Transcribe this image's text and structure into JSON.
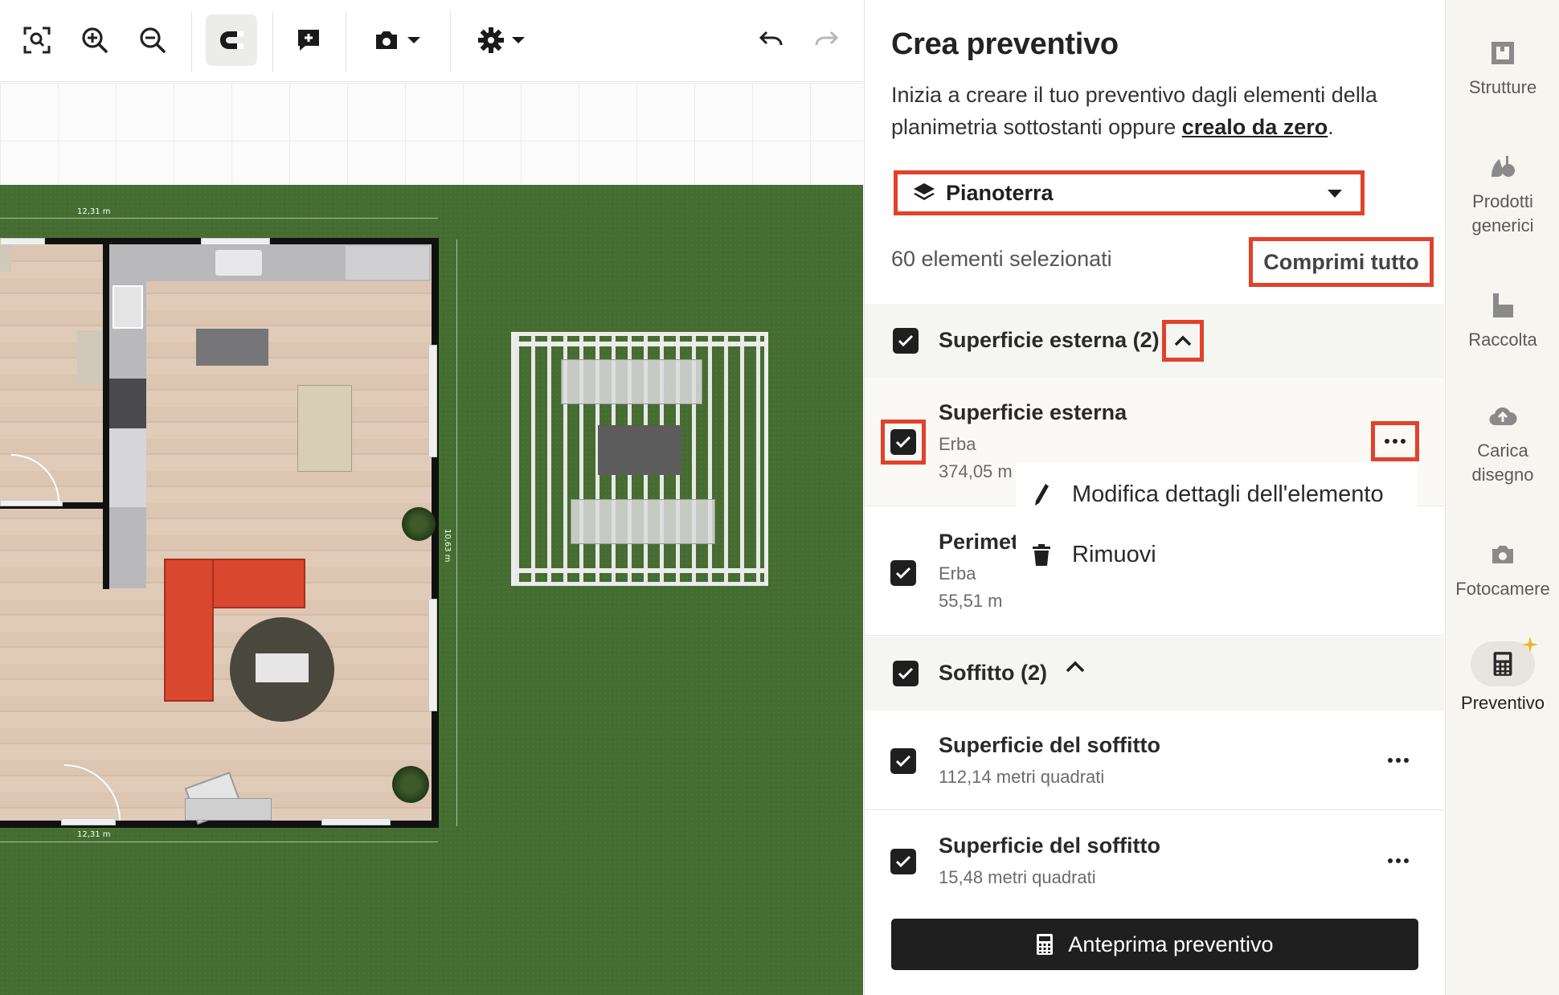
{
  "panel": {
    "title": "Crea preventivo",
    "description_prefix": "Inizia a creare il tuo preventivo dagli elementi della planimetria sottostanti oppure ",
    "description_link": "crealo da zero",
    "description_suffix": ".",
    "floor_selector": {
      "value": "Pianoterra",
      "icon": "layers-icon"
    },
    "selected_count": "60 elementi selezionati",
    "collapse_all": "Comprimi tutto",
    "groups": [
      {
        "title": "Superficie esterna (2)",
        "checked": true,
        "items": [
          {
            "title": "Superficie esterna",
            "material": "Erba",
            "area": "374,05 m",
            "checked": true
          },
          {
            "title": "Perimet",
            "material": "Erba",
            "area": "55,51 m",
            "checked": true
          }
        ]
      },
      {
        "title": "Soffitto (2)",
        "checked": true,
        "items": [
          {
            "title": "Superficie del soffitto",
            "area": "112,14 metri quadrati",
            "checked": true
          },
          {
            "title": "Superficie del soffitto",
            "area": "15,48 metri quadrati",
            "checked": true
          }
        ]
      }
    ],
    "context_menu": {
      "items": [
        {
          "label": "Modifica dettagli dell'elemento",
          "icon": "pencil-icon"
        },
        {
          "label": "Rimuovi",
          "icon": "trash-icon"
        }
      ]
    },
    "preview_button": "Anteprima preventivo"
  },
  "rail": {
    "items": [
      {
        "label": "Strutture",
        "icon": "structure-icon"
      },
      {
        "label": "Prodotti generici",
        "icon": "products-icon"
      },
      {
        "label": "Raccolta",
        "icon": "collection-icon"
      },
      {
        "label": "Carica disegno",
        "icon": "upload-cloud-icon"
      },
      {
        "label": "Fotocamere",
        "icon": "camera-icon"
      },
      {
        "label": "Preventivo",
        "icon": "calculator-icon",
        "active": true
      }
    ]
  },
  "canvas": {
    "dimension_top": "12,31 m",
    "dimension_bottom": "12,31 m",
    "dimension_side": "10,63 m"
  },
  "colors": {
    "highlight": "#e2412a",
    "grass": "#456d31",
    "button_dark": "#1f1f1f",
    "sofa": "#d9472f"
  }
}
